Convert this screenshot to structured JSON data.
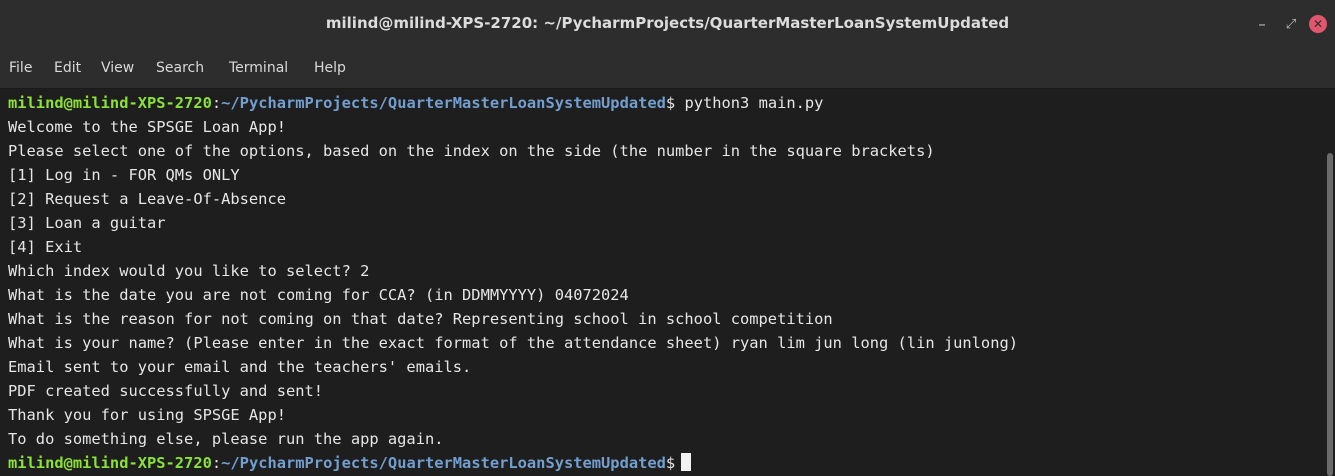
{
  "window": {
    "title": "milind@milind-XPS-2720: ~/PycharmProjects/QuarterMasterLoanSystemUpdated",
    "minimize_glyph": "–",
    "maximize_glyph": "⤢",
    "close_glyph": "✕"
  },
  "menu": [
    "File",
    "Edit",
    "View",
    "Search",
    "Terminal",
    "Help"
  ],
  "prompt": {
    "user_host": "milind@milind-XPS-2720",
    "path": "~/PycharmProjects/QuarterMasterLoanSystemUpdated",
    "command": "python3 main.py"
  },
  "output": [
    "Welcome to the SPSGE Loan App!",
    "Please select one of the options, based on the index on the side (the number in the square brackets)",
    "[1] Log in - FOR QMs ONLY",
    "[2] Request a Leave-Of-Absence",
    "[3] Loan a guitar",
    "[4] Exit",
    "Which index would you like to select? 2",
    "What is the date you are not coming for CCA? (in DDMMYYYY) 04072024",
    "What is the reason for not coming on that date? Representing school in school competition",
    "What is your name? (Please enter in the exact format of the attendance sheet) ryan lim jun long (lin junlong)",
    "Email sent to your email and the teachers' emails.",
    "PDF created successfully and sent!",
    "Thank you for using SPSGE App!",
    "To do something else, please run the app again."
  ],
  "colors": {
    "user_host": "#8ae234",
    "path": "#729fcf",
    "text": "#e6e6e6",
    "background": "#1e1e1e",
    "close_button": "#e0566d"
  }
}
